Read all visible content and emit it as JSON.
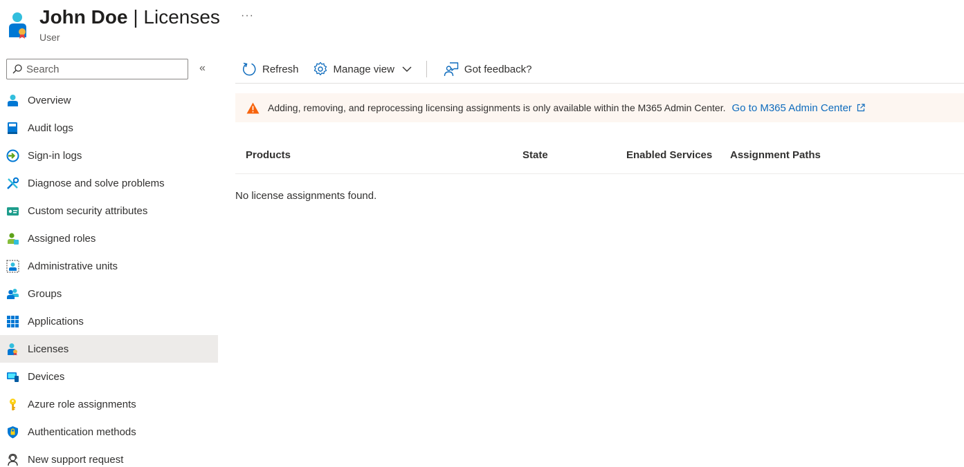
{
  "header": {
    "name": "John Doe",
    "separator": "|",
    "section": "Licenses",
    "subtitle": "User",
    "more_label": "···"
  },
  "sidebar": {
    "search_placeholder": "Search",
    "collapse_label": "«",
    "items": [
      {
        "label": "Overview",
        "icon": "user-icon"
      },
      {
        "label": "Audit logs",
        "icon": "book-icon"
      },
      {
        "label": "Sign-in logs",
        "icon": "sign-in-icon"
      },
      {
        "label": "Diagnose and solve problems",
        "icon": "wrench-icon"
      },
      {
        "label": "Custom security attributes",
        "icon": "id-card-icon"
      },
      {
        "label": "Assigned roles",
        "icon": "user-role-icon"
      },
      {
        "label": "Administrative units",
        "icon": "admin-units-icon"
      },
      {
        "label": "Groups",
        "icon": "groups-icon"
      },
      {
        "label": "Applications",
        "icon": "grid-icon"
      },
      {
        "label": "Licenses",
        "icon": "license-icon",
        "selected": true
      },
      {
        "label": "Devices",
        "icon": "monitor-icon"
      },
      {
        "label": "Azure role assignments",
        "icon": "key-icon"
      },
      {
        "label": "Authentication methods",
        "icon": "shield-icon"
      },
      {
        "label": "New support request",
        "icon": "support-icon"
      }
    ]
  },
  "toolbar": {
    "refresh_label": "Refresh",
    "manage_view_label": "Manage view",
    "feedback_label": "Got feedback?"
  },
  "banner": {
    "message": "Adding, removing, and reprocessing licensing assignments is only available within the M365 Admin Center.",
    "link_label": "Go to M365 Admin Center"
  },
  "table": {
    "columns": [
      "Products",
      "State",
      "Enabled Services",
      "Assignment Paths"
    ],
    "empty_message": "No license assignments found."
  },
  "colors": {
    "accent": "#0f6cbd",
    "warning": "#f7630c",
    "selected_bg": "#edebe9",
    "banner_bg": "#fdf6f1"
  }
}
